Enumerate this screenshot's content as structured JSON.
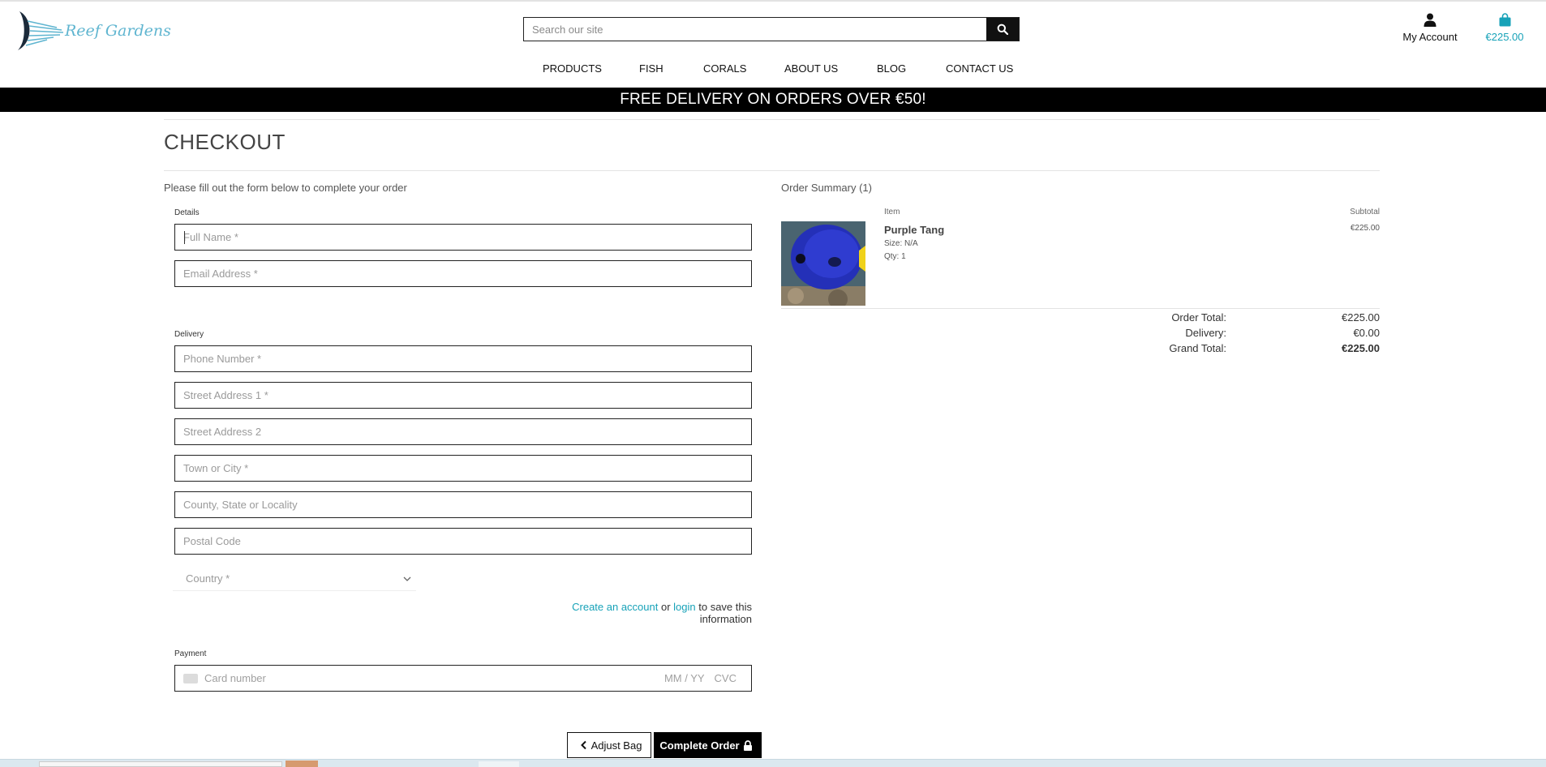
{
  "brand": {
    "name": "Reef Gardens"
  },
  "header": {
    "search_placeholder": "Search our site",
    "account_label": "My Account",
    "bag_total": "€225.00"
  },
  "nav": [
    "PRODUCTS",
    "FISH",
    "CORALS",
    "ABOUT US",
    "BLOG",
    "CONTACT US"
  ],
  "banner": "FREE DELIVERY ON ORDERS OVER €50!",
  "checkout": {
    "title": "CHECKOUT",
    "intro": "Please fill out the form below to complete your order",
    "details_label": "Details",
    "delivery_label": "Delivery",
    "payment_label": "Payment",
    "fields": {
      "full_name": "Full Name *",
      "email": "Email Address *",
      "phone": "Phone Number *",
      "street1": "Street Address 1 *",
      "street2": "Street Address 2",
      "town": "Town or City *",
      "county": "County, State or Locality",
      "postcode": "Postal Code"
    },
    "country": "Country *",
    "save_info": {
      "create": "Create an account",
      "or": " or ",
      "login": "login",
      "tail": " to save this information"
    },
    "card": {
      "number": "Card number",
      "expiry": "MM / YY",
      "cvc": "CVC"
    },
    "buttons": {
      "adjust": "Adjust Bag",
      "complete": "Complete Order"
    }
  },
  "summary": {
    "title": "Order Summary (1)",
    "col_item": "Item",
    "col_subtotal": "Subtotal",
    "item": {
      "name": "Purple Tang",
      "size": "Size: N/A",
      "qty": "Qty: 1",
      "subtotal": "€225.00"
    },
    "totals": {
      "order_label": "Order Total:",
      "order_value": "€225.00",
      "delivery_label": "Delivery:",
      "delivery_value": "€0.00",
      "grand_label": "Grand Total:",
      "grand_value": "€225.00"
    }
  },
  "colors": {
    "accent": "#17a2b8",
    "logo": "#5fb5d0",
    "banner_bg": "#000000"
  }
}
